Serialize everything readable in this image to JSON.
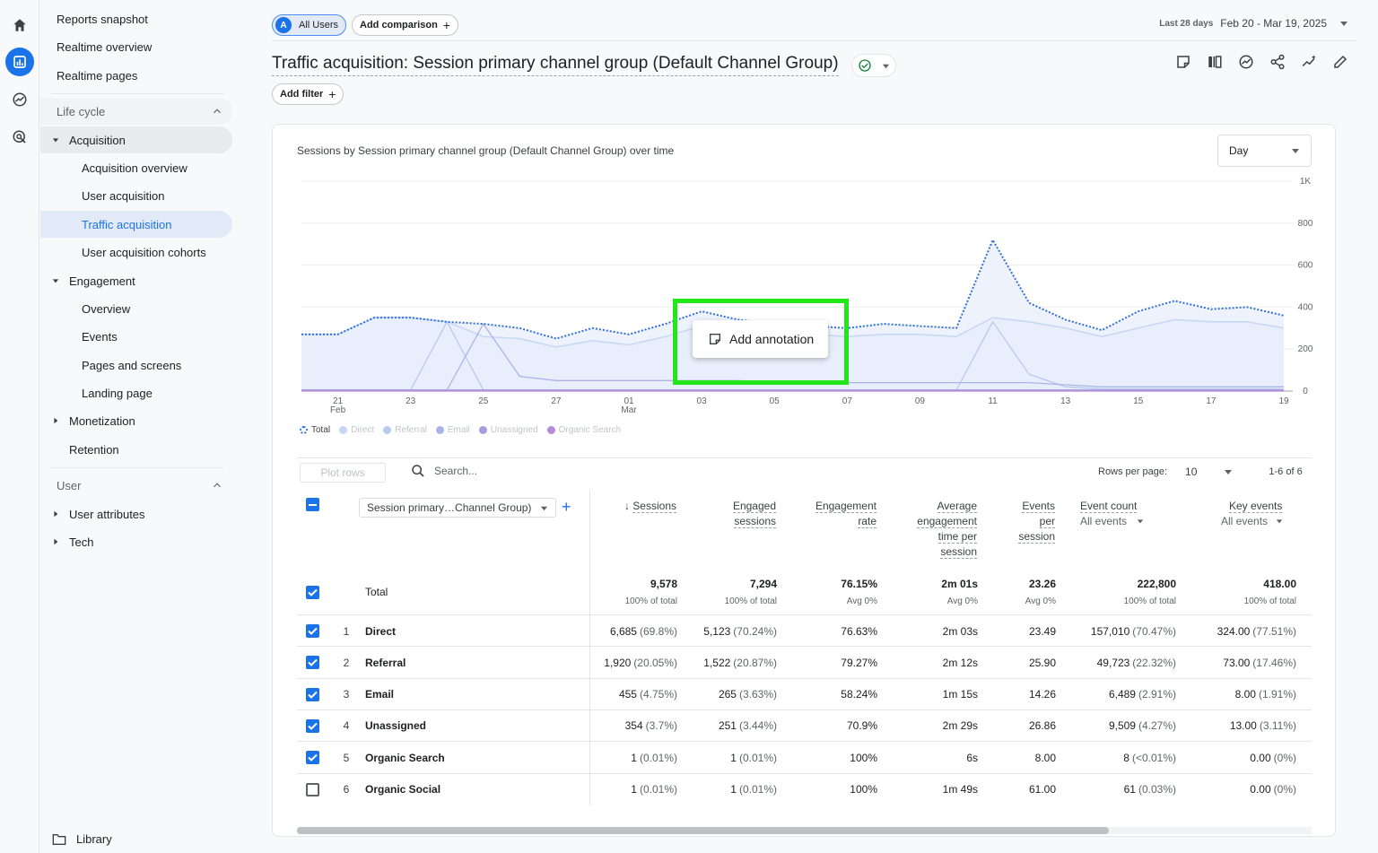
{
  "sidebar": {
    "top_items": [
      "Reports snapshot",
      "Realtime overview",
      "Realtime pages"
    ],
    "lifecycle_label": "Life cycle",
    "acquisition": {
      "label": "Acquisition",
      "items": [
        "Acquisition overview",
        "User acquisition",
        "Traffic acquisition",
        "User acquisition cohorts"
      ]
    },
    "engagement": {
      "label": "Engagement",
      "items": [
        "Overview",
        "Events",
        "Pages and screens",
        "Landing page"
      ]
    },
    "monetization_label": "Monetization",
    "retention_label": "Retention",
    "user_label": "User",
    "user_items": [
      "User attributes",
      "Tech"
    ],
    "library_label": "Library"
  },
  "header": {
    "segment_badge": "A",
    "segment_label": "All Users",
    "add_comparison": "Add comparison",
    "date_prefix": "Last 28 days",
    "date_range": "Feb 20 - Mar 19, 2025",
    "title": "Traffic acquisition: Session primary channel group (Default Channel Group)",
    "add_filter": "Add filter"
  },
  "chart": {
    "title": "Sessions by Session primary channel group (Default Channel Group) over time",
    "granularity": "Day",
    "annotation_label": "Add annotation",
    "legend": [
      "Total",
      "Direct",
      "Referral",
      "Email",
      "Unassigned",
      "Organic Search"
    ]
  },
  "chart_data": {
    "type": "line",
    "title": "Sessions by Session primary channel group (Default Channel Group) over time",
    "x": [
      "Feb 20",
      "Feb 21",
      "Feb 22",
      "Feb 23",
      "Feb 24",
      "Feb 25",
      "Feb 26",
      "Feb 27",
      "Feb 28",
      "Mar 01",
      "Mar 02",
      "Mar 03",
      "Mar 04",
      "Mar 05",
      "Mar 06",
      "Mar 07",
      "Mar 08",
      "Mar 09",
      "Mar 10",
      "Mar 11",
      "Mar 12",
      "Mar 13",
      "Mar 14",
      "Mar 15",
      "Mar 16",
      "Mar 17",
      "Mar 18",
      "Mar 19"
    ],
    "x_tick_labels": [
      "21\nFeb",
      "23",
      "25",
      "27",
      "01\nMar",
      "03",
      "05",
      "07",
      "09",
      "11",
      "13",
      "15",
      "17",
      "19"
    ],
    "y_tick_labels": [
      "0",
      "200",
      "400",
      "600",
      "800",
      "1K"
    ],
    "ylim": [
      0,
      1000
    ],
    "series": [
      {
        "name": "Total",
        "values": [
          270,
          270,
          350,
          350,
          330,
          320,
          300,
          250,
          300,
          270,
          320,
          380,
          340,
          320,
          310,
          300,
          320,
          310,
          300,
          720,
          420,
          340,
          290,
          380,
          430,
          390,
          400,
          360
        ]
      },
      {
        "name": "Direct",
        "values": [
          270,
          270,
          350,
          350,
          330,
          260,
          250,
          210,
          240,
          220,
          260,
          310,
          290,
          280,
          270,
          260,
          270,
          270,
          260,
          350,
          330,
          300,
          260,
          300,
          340,
          330,
          330,
          300
        ]
      },
      {
        "name": "Referral",
        "values": [
          5,
          5,
          5,
          5,
          330,
          5,
          5,
          5,
          5,
          5,
          5,
          5,
          5,
          5,
          5,
          5,
          5,
          5,
          5,
          330,
          80,
          20,
          10,
          10,
          10,
          10,
          10,
          10
        ]
      },
      {
        "name": "Email",
        "values": [
          5,
          5,
          5,
          5,
          5,
          320,
          70,
          50,
          50,
          50,
          50,
          50,
          50,
          40,
          40,
          40,
          40,
          40,
          40,
          40,
          40,
          30,
          20,
          20,
          20,
          20,
          20,
          20
        ]
      },
      {
        "name": "Unassigned",
        "values": [
          5,
          5,
          5,
          5,
          5,
          5,
          5,
          5,
          5,
          5,
          5,
          5,
          5,
          5,
          5,
          5,
          5,
          5,
          5,
          5,
          5,
          5,
          5,
          5,
          5,
          5,
          5,
          5
        ]
      },
      {
        "name": "Organic Search",
        "values": [
          0,
          0,
          0,
          0,
          0,
          0,
          0,
          0,
          0,
          0,
          0,
          0,
          0,
          0,
          0,
          0,
          0,
          0,
          0,
          0,
          0,
          0,
          0,
          0,
          0,
          0,
          0,
          0
        ]
      }
    ]
  },
  "table": {
    "plot_rows": "Plot rows",
    "search_placeholder": "Search...",
    "rows_per_page_label": "Rows per page:",
    "rows_per_page": "10",
    "pagination": "1-6 of 6",
    "dimension_label": "Session primary…Channel Group)",
    "headers": {
      "sessions": "Sessions",
      "engaged": [
        "Engaged",
        "sessions"
      ],
      "engagement_rate": [
        "Engagement",
        "rate"
      ],
      "avg_time": [
        "Average",
        "engagement",
        "time per",
        "session"
      ],
      "events_per": [
        "Events",
        "per",
        "session"
      ],
      "event_count": "Event count",
      "event_count_sub": "All events",
      "key_events": "Key events",
      "key_events_sub": "All events"
    },
    "total": {
      "label": "Total",
      "sessions": "9,578",
      "sessions_sub": "100% of total",
      "engaged": "7,294",
      "engaged_sub": "100% of total",
      "rate": "76.15%",
      "rate_sub": "Avg 0%",
      "avg_time": "2m 01s",
      "avg_time_sub": "Avg 0%",
      "events_per": "23.26",
      "events_per_sub": "Avg 0%",
      "event_count": "222,800",
      "event_count_sub": "100% of total",
      "key_events": "418.00",
      "key_events_sub": "100% of total"
    },
    "rows": [
      {
        "idx": "1",
        "name": "Direct",
        "sessions": "6,685",
        "sessions_pct": "(69.8%)",
        "engaged": "5,123",
        "engaged_pct": "(70.24%)",
        "rate": "76.63%",
        "avg_time": "2m 03s",
        "events_per": "23.49",
        "event_count": "157,010",
        "event_count_pct": "(70.47%)",
        "key_events": "324.00",
        "key_events_pct": "(77.51%)",
        "checked": true
      },
      {
        "idx": "2",
        "name": "Referral",
        "sessions": "1,920",
        "sessions_pct": "(20.05%)",
        "engaged": "1,522",
        "engaged_pct": "(20.87%)",
        "rate": "79.27%",
        "avg_time": "2m 12s",
        "events_per": "25.90",
        "event_count": "49,723",
        "event_count_pct": "(22.32%)",
        "key_events": "73.00",
        "key_events_pct": "(17.46%)",
        "checked": true
      },
      {
        "idx": "3",
        "name": "Email",
        "sessions": "455",
        "sessions_pct": "(4.75%)",
        "engaged": "265",
        "engaged_pct": "(3.63%)",
        "rate": "58.24%",
        "avg_time": "1m 15s",
        "events_per": "14.26",
        "event_count": "6,489",
        "event_count_pct": "(2.91%)",
        "key_events": "8.00",
        "key_events_pct": "(1.91%)",
        "checked": true
      },
      {
        "idx": "4",
        "name": "Unassigned",
        "sessions": "354",
        "sessions_pct": "(3.7%)",
        "engaged": "251",
        "engaged_pct": "(3.44%)",
        "rate": "70.9%",
        "avg_time": "2m 29s",
        "events_per": "26.86",
        "event_count": "9,509",
        "event_count_pct": "(4.27%)",
        "key_events": "13.00",
        "key_events_pct": "(3.11%)",
        "checked": true
      },
      {
        "idx": "5",
        "name": "Organic Search",
        "sessions": "1",
        "sessions_pct": "(0.01%)",
        "engaged": "1",
        "engaged_pct": "(0.01%)",
        "rate": "100%",
        "avg_time": "6s",
        "events_per": "8.00",
        "event_count": "8",
        "event_count_pct": "(<0.01%)",
        "key_events": "0.00",
        "key_events_pct": "(0%)",
        "checked": true
      },
      {
        "idx": "6",
        "name": "Organic Social",
        "sessions": "1",
        "sessions_pct": "(0.01%)",
        "engaged": "1",
        "engaged_pct": "(0.01%)",
        "rate": "100%",
        "avg_time": "1m 49s",
        "events_per": "61.00",
        "event_count": "61",
        "event_count_pct": "(0.03%)",
        "key_events": "0.00",
        "key_events_pct": "(0%)",
        "checked": false
      }
    ]
  },
  "colors": {
    "accent": "#1a73e8",
    "total_line": "#2f6fdb",
    "direct": "#c6d7f5",
    "referral": "#b9c9f0",
    "email": "#aab4e8",
    "unassigned": "#a79cdd",
    "organic_search": "#b58ad6",
    "annotation_highlight": "#22e51a"
  }
}
